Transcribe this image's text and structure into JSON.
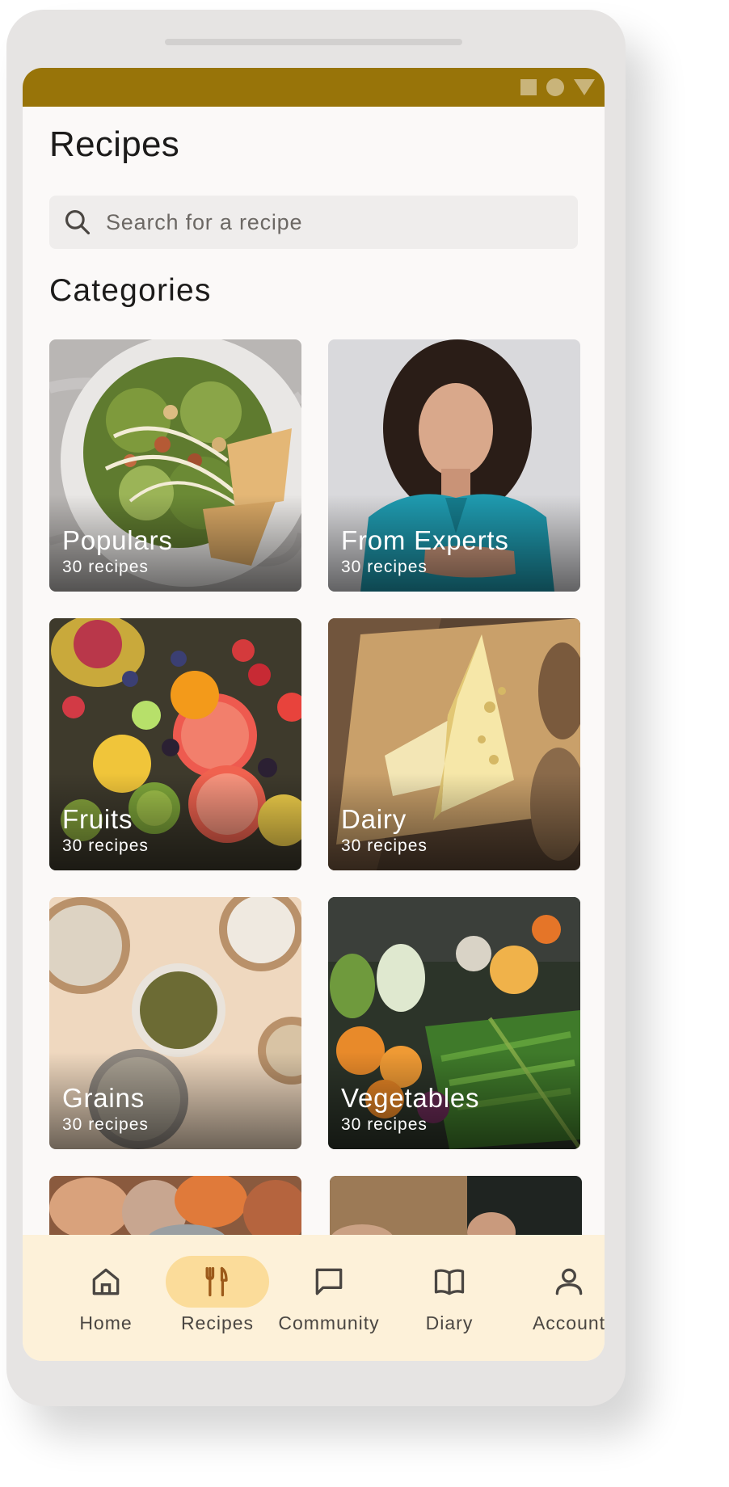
{
  "status_bar": {
    "icons": [
      "square-icon",
      "circle-icon",
      "triangle-icon"
    ],
    "color": "#987409"
  },
  "header": {
    "title": "Recipes"
  },
  "search": {
    "placeholder": "Search for a recipe",
    "icon": "search-icon"
  },
  "categories": {
    "title": "Categories",
    "items": [
      {
        "name": "Populars",
        "count": "30 recipes"
      },
      {
        "name": "From Experts",
        "count": "30 recipes"
      },
      {
        "name": "Fruits",
        "count": "30 recipes"
      },
      {
        "name": "Dairy",
        "count": "30 recipes"
      },
      {
        "name": "Grains",
        "count": "30 recipes"
      },
      {
        "name": "Vegetables",
        "count": "30 recipes"
      }
    ]
  },
  "nav": {
    "active": "Recipes",
    "items": [
      {
        "label": "Home",
        "icon": "home-icon"
      },
      {
        "label": "Recipes",
        "icon": "fork-knife-icon"
      },
      {
        "label": "Community",
        "icon": "chat-bubble-icon"
      },
      {
        "label": "Diary",
        "icon": "book-icon"
      },
      {
        "label": "Account",
        "icon": "person-icon"
      }
    ]
  },
  "colors": {
    "accent": "#987409",
    "nav_background": "#fdf1d9",
    "nav_active_pill": "#fbdc9a",
    "active_icon": "#9c5a1a"
  }
}
